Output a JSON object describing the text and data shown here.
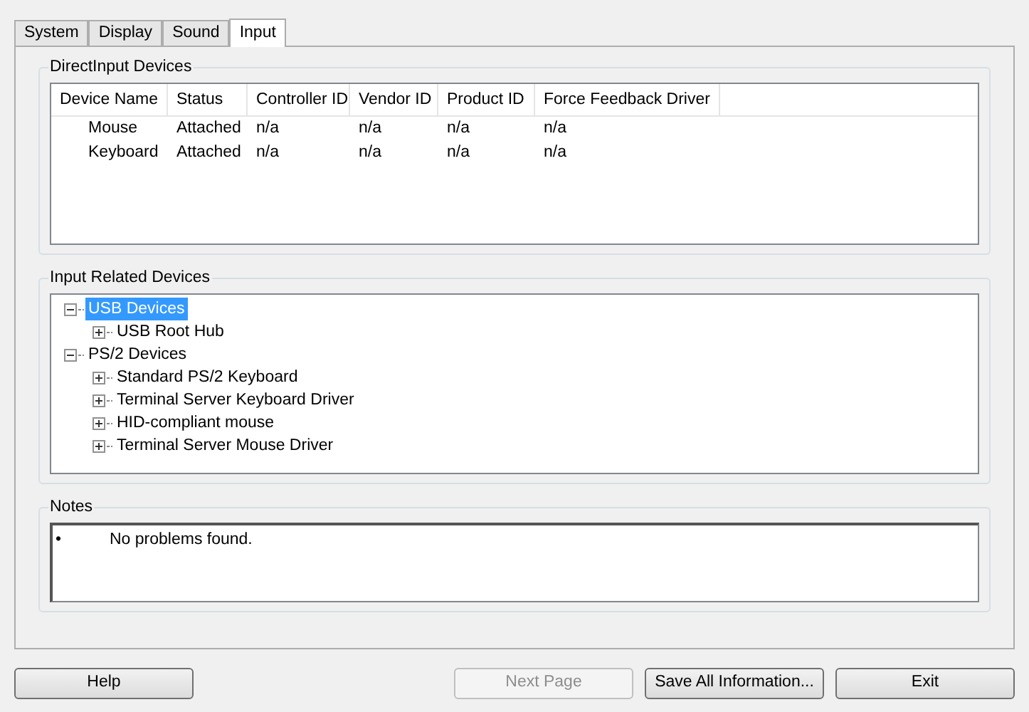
{
  "tabs": [
    {
      "label": "System",
      "selected": false
    },
    {
      "label": "Display",
      "selected": false
    },
    {
      "label": "Sound",
      "selected": false
    },
    {
      "label": "Input",
      "selected": true
    }
  ],
  "direct_input": {
    "title": "DirectInput Devices",
    "columns": [
      "Device Name",
      "Status",
      "Controller ID",
      "Vendor ID",
      "Product ID",
      "Force Feedback Driver"
    ],
    "rows": [
      [
        "Mouse",
        "Attached",
        "n/a",
        "n/a",
        "n/a",
        "n/a"
      ],
      [
        "Keyboard",
        "Attached",
        "n/a",
        "n/a",
        "n/a",
        "n/a"
      ]
    ]
  },
  "input_related": {
    "title": "Input Related Devices",
    "tree": [
      {
        "label": "USB Devices",
        "selected": true,
        "expanded": true,
        "children": [
          {
            "label": "USB Root Hub",
            "selected": false,
            "expanded": false
          }
        ]
      },
      {
        "label": "PS/2 Devices",
        "selected": false,
        "expanded": true,
        "children": [
          {
            "label": "Standard PS/2 Keyboard",
            "selected": false,
            "expanded": false
          },
          {
            "label": "Terminal Server Keyboard Driver",
            "selected": false,
            "expanded": false
          },
          {
            "label": "HID-compliant mouse",
            "selected": false,
            "expanded": false
          },
          {
            "label": "Terminal Server Mouse Driver",
            "selected": false,
            "expanded": false
          }
        ]
      }
    ]
  },
  "notes": {
    "title": "Notes",
    "items": [
      {
        "bullet": "•",
        "text": "No problems found."
      }
    ]
  },
  "buttons": [
    {
      "label": "Help",
      "disabled": false
    },
    {
      "label": "Next Page",
      "disabled": true
    },
    {
      "label": "Save All Information...",
      "disabled": false
    },
    {
      "label": "Exit",
      "disabled": false
    }
  ]
}
